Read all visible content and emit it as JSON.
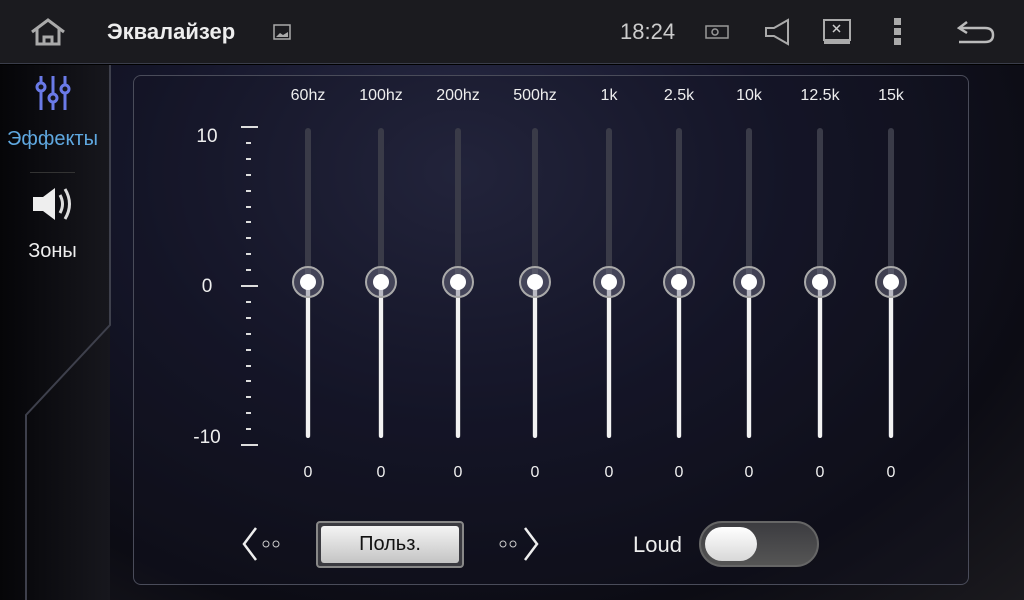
{
  "topbar": {
    "title": "Эквалайзер",
    "time": "18:24"
  },
  "sidebar": {
    "items": [
      {
        "label": "Эффекты",
        "active": true
      },
      {
        "label": "Зоны",
        "active": false
      }
    ]
  },
  "scale": {
    "max": "10",
    "mid": "0",
    "min": "-10"
  },
  "bands": [
    {
      "freq": "60hz",
      "value": 0
    },
    {
      "freq": "100hz",
      "value": 0
    },
    {
      "freq": "200hz",
      "value": 0
    },
    {
      "freq": "500hz",
      "value": 0
    },
    {
      "freq": "1k",
      "value": 0
    },
    {
      "freq": "2.5k",
      "value": 0
    },
    {
      "freq": "10k",
      "value": 0
    },
    {
      "freq": "12.5k",
      "value": 0
    },
    {
      "freq": "15k",
      "value": 0
    }
  ],
  "controls": {
    "preset": "Польз.",
    "loud_label": "Loud",
    "loud_on": false
  },
  "colors": {
    "accent": "#5fa8e0",
    "icon_active": "#6a7ae8"
  }
}
